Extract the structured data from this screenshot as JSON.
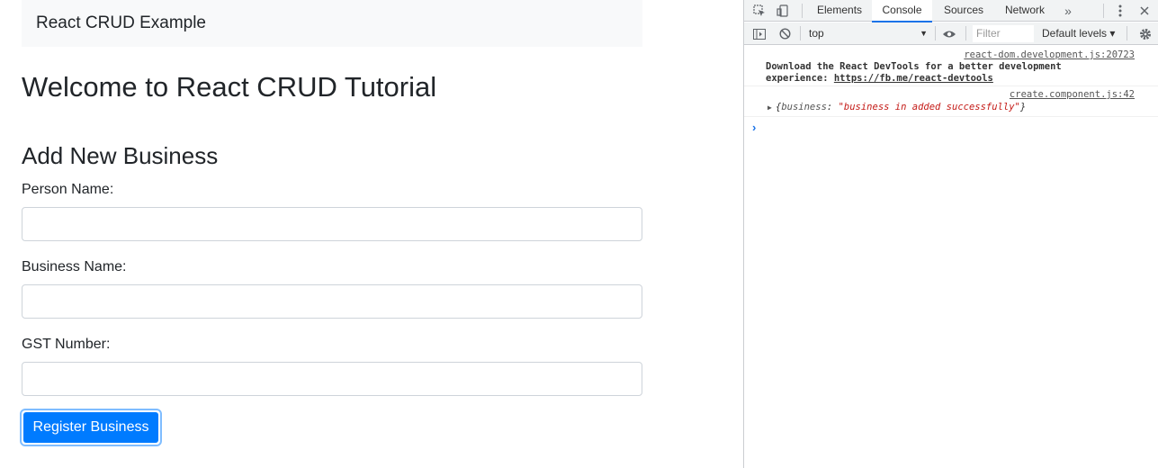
{
  "page": {
    "navbar_brand": "React CRUD Example",
    "heading": "Welcome to React CRUD Tutorial",
    "form_title": "Add New Business",
    "fields": [
      {
        "label": "Person Name:",
        "value": ""
      },
      {
        "label": "Business Name:",
        "value": ""
      },
      {
        "label": "GST Number:",
        "value": ""
      }
    ],
    "submit_label": "Register Business"
  },
  "devtools": {
    "tabs": [
      "Elements",
      "Console",
      "Sources",
      "Network"
    ],
    "active_tab": "Console",
    "overflow_icon": "»",
    "context": "top",
    "filter_placeholder": "Filter",
    "levels": "Default levels ▾",
    "messages": [
      {
        "source": "react-dom.development.js:20723",
        "line1": "Download the React DevTools for a better development",
        "line2_prefix": "experience: ",
        "link": "https://fb.me/react-devtools"
      },
      {
        "source": "create.component.js:42",
        "key": "business",
        "value": "\"business in added successfully\""
      }
    ],
    "prompt": "›"
  },
  "colors": {
    "primary": "#007bff",
    "focus_ring": "#80bdff",
    "navbar_bg": "#f8f9fa",
    "devtools_accent": "#1a73e8"
  },
  "icons": [
    "inspect-element-icon",
    "device-toolbar-icon",
    "more-vert-icon",
    "close-icon",
    "sidebar-toggle-icon",
    "clear-console-icon",
    "eye-icon",
    "settings-gear-icon"
  ]
}
